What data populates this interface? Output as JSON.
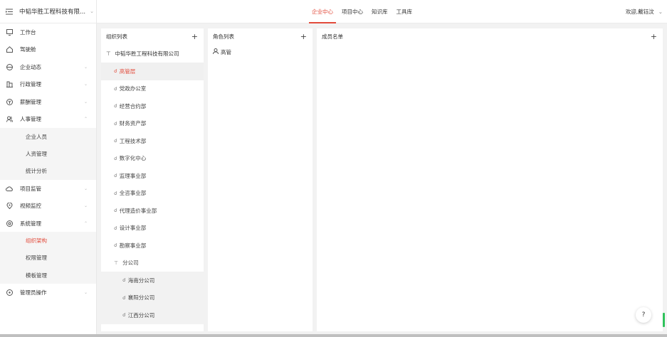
{
  "sidebar": {
    "org_name": "中韬华胜工程科技有限...",
    "menu": [
      {
        "label": "工作台"
      },
      {
        "label": "驾驶舱"
      },
      {
        "label": "企业动态"
      },
      {
        "label": "行政管理"
      },
      {
        "label": "薪酬管理"
      },
      {
        "label": "人事管理"
      },
      {
        "label": "项目监管"
      },
      {
        "label": "视频监控"
      },
      {
        "label": "系统管理"
      },
      {
        "label": "管理员操作"
      }
    ],
    "hr_sub": [
      "企业人员",
      "人资管理",
      "统计分析"
    ],
    "sys_sub": [
      "组织架构",
      "权限管理",
      "模板管理"
    ]
  },
  "topbar": {
    "tabs": [
      "企业中心",
      "项目中心",
      "知识库",
      "工具库"
    ],
    "welcome": "欢迎,戴钰汶"
  },
  "org_panel": {
    "title": "组织列表",
    "root": "中韬华胜工程科技有限公司",
    "nodes": [
      "高管层",
      "党政办公室",
      "经营合约部",
      "财务资产部",
      "工程技术部",
      "数字化中心",
      "监理事业部",
      "全咨事业部",
      "代理造价事业部",
      "设计事业部",
      "勘察事业部"
    ],
    "branch": "分公司",
    "branch_nodes": [
      "海南分公司",
      "襄阳分公司",
      "江西分公司"
    ]
  },
  "role_panel": {
    "title": "角色列表",
    "roles": [
      "高管"
    ]
  },
  "member_panel": {
    "title": "成员名单"
  },
  "help": "?",
  "colors": {
    "accent": "#e24b3b"
  }
}
